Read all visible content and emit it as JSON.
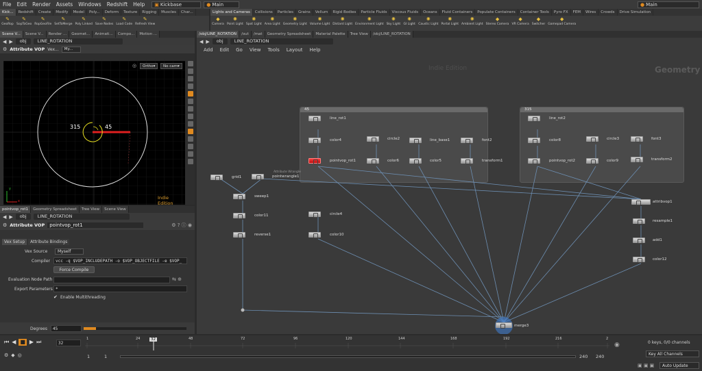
{
  "menubar": {
    "items": [
      "File",
      "Edit",
      "Render",
      "Assets",
      "Windows",
      "Redshift",
      "Help"
    ],
    "desktop": "Kickbase",
    "context": "Main",
    "context_right": "Main"
  },
  "shelf_left": {
    "tabs": [
      "Kick...",
      "Redshift",
      "Create",
      "Modify",
      "Model",
      "Poly...",
      "Deform",
      "Texture",
      "Rigging",
      "Muscles",
      "Char..."
    ],
    "tools": [
      "GeoRop",
      "SopToGeo",
      "RopGeoFile",
      "SetToMerge",
      "Poly Linked",
      "Save Nodes",
      "Load Code",
      "Refresh View"
    ]
  },
  "shelf_right": {
    "tabs": [
      "Lights and Cameras",
      "Collisions",
      "Particles",
      "Grains",
      "Vellum",
      "Rigid Bodies",
      "Particle Fluids",
      "Viscous Fluids",
      "Oceans",
      "Fluid Containers",
      "Populate Containers",
      "Container Tools",
      "Pyro FX",
      "FEM",
      "Wires",
      "Crowds",
      "Drive Simulation"
    ],
    "tools": [
      "Camera",
      "Point Light",
      "Spot Light",
      "Area Light",
      "Geometry Light",
      "Volume Light",
      "Distant Light",
      "Environment Light",
      "Sky Light",
      "GI Light",
      "Caustic Light",
      "Portal Light",
      "Ambient Light",
      "Stereo Camera",
      "VR Camera",
      "Switcher",
      "Gamepad Camera"
    ]
  },
  "viewport": {
    "tabs": [
      "Scene V...",
      "Scene V...",
      "Render ...",
      "Geomet...",
      "Animati...",
      "Compo...",
      "Motion ..."
    ],
    "path": "obj",
    "path2": "LINE_ROTATION",
    "title": "Attribute VOP",
    "subtitle": "Vex...",
    "my_dropdown": "My...",
    "view": "Ortho",
    "camera": "No cam",
    "label_315": "315",
    "label_45": "45",
    "watermark": "Indie Edition",
    "axis_y": "y",
    "axis_x": "x"
  },
  "parm": {
    "tabs": [
      "pointvop_rot1",
      "Geometry Spreadsheet",
      "Tree View",
      "Scene View"
    ],
    "path": "obj",
    "path2": "LINE_ROTATION",
    "node_type": "Attribute VOP",
    "node_name": "pointvop_rot1",
    "subtabs": [
      "Vex Setup",
      "Attribute Bindings"
    ],
    "vex_source_label": "Vex Source",
    "vex_source_value": "Myself",
    "compiler_label": "Compiler",
    "compiler_value": "vcc -q $VOP_INCLUDEPATH -o $VOP_OBJECTFILE -e $VOP_",
    "force_compile": "Force Compile",
    "eval_path_label": "Evaluation Node Path",
    "export_label": "Export Parameters",
    "export_value": "*",
    "multithread_label": "Enable Multithreading",
    "degrees_label": "Degrees",
    "degrees_value": "45"
  },
  "network": {
    "tabs": [
      "/obj/LINE_ROTATION",
      "/out",
      "/mat",
      "Geometry Spreadsheet",
      "Material Palette",
      "Tree View",
      "/obj/LINE_ROTATION"
    ],
    "path": "obj",
    "path2": "LINE_ROTATION",
    "menu": [
      "Add",
      "Edit",
      "Go",
      "View",
      "Tools",
      "Layout",
      "Help"
    ],
    "watermark": "Indie Edition",
    "context_label": "Geometry",
    "box1_title": "45",
    "box2_title": "315",
    "nodes": {
      "line_rot1": "line_rot1",
      "color4": "color4",
      "circle2": "circle2",
      "line_base1": "line_base1",
      "font2": "font2",
      "pointvop_rot1": "pointvop_rot1",
      "color6": "color6",
      "color5": "color5",
      "transform1": "transform1",
      "line_rot2": "line_rot2",
      "color8": "color8",
      "circle3": "circle3",
      "font3": "font3",
      "pointvop_rot2": "pointvop_rot2",
      "color9": "color9",
      "transform2": "transform2",
      "grid1": "grid1",
      "pointwrangle1": "pointwrangle1",
      "pointwrangle1_note": "Attribute Wrangle",
      "sweep1": "sweep1",
      "color11": "color11",
      "reverse1": "reverse1",
      "circle4": "circle4",
      "color10": "color10",
      "attribvop1": "attribvop1",
      "resample1": "resample1",
      "add1": "add1",
      "color12": "color12",
      "merge3": "merge3"
    }
  },
  "timeline": {
    "current_frame": "32",
    "frame_marker": "32",
    "ticks": [
      "1",
      "24",
      "48",
      "72",
      "96",
      "120",
      "144",
      "168",
      "192",
      "216",
      "2"
    ],
    "start": "1",
    "start2": "1",
    "end": "240",
    "end2": "240",
    "keys": "0 keys, 0/0 channels",
    "key_all": "Key All Channels",
    "auto_update": "Auto Update"
  },
  "colors": {
    "accent": "#e08a20",
    "selected": "#e02020",
    "wire": "#6d8fb3"
  }
}
